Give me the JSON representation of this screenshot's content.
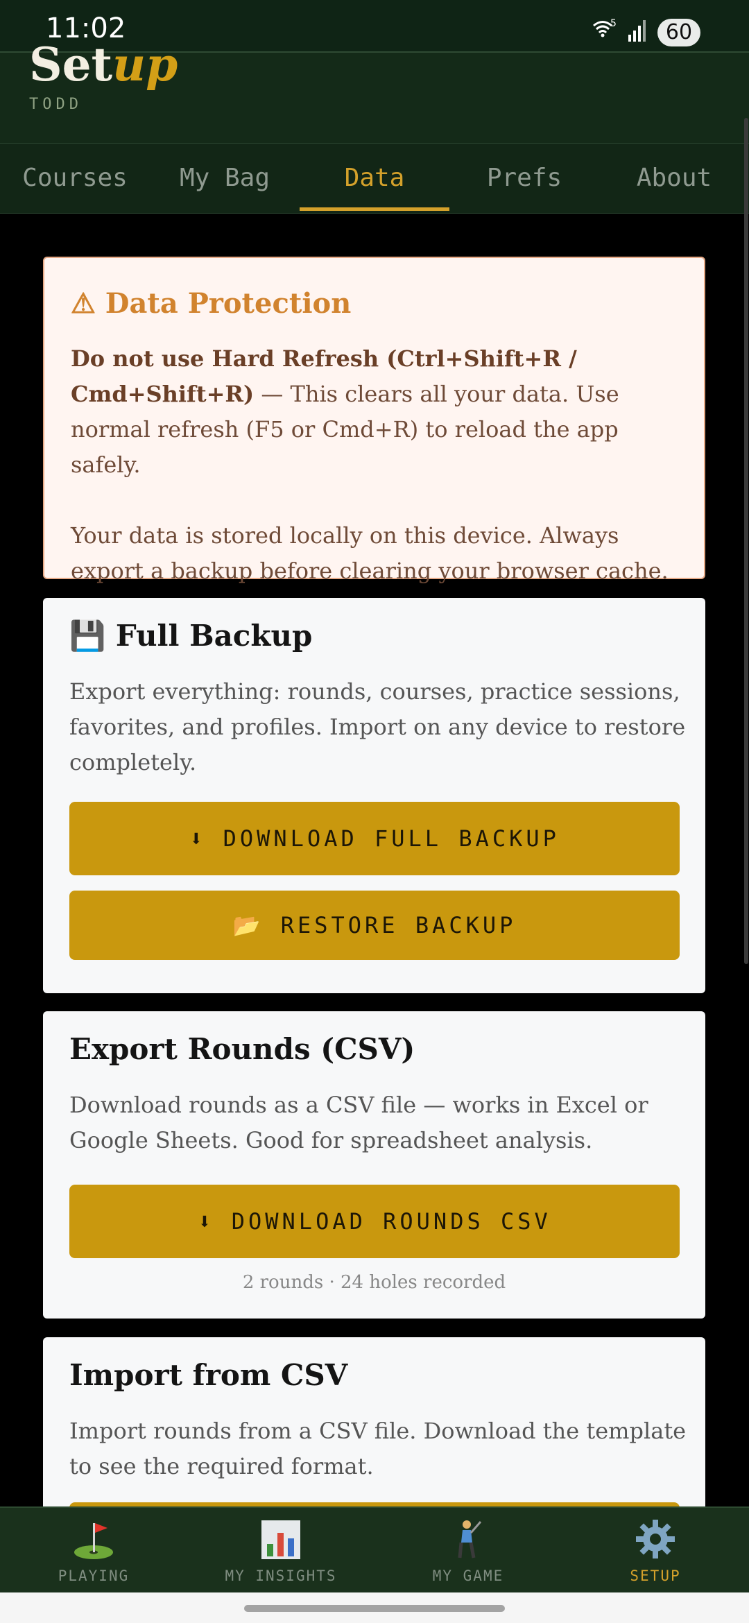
{
  "status": {
    "time": "11:02",
    "wifi_badge": "5",
    "battery": "60"
  },
  "header": {
    "title_main": "Set",
    "title_accent": "up",
    "user": "TODD"
  },
  "tabs": [
    {
      "label": "Courses"
    },
    {
      "label": "My Bag"
    },
    {
      "label": "Data"
    },
    {
      "label": "Prefs"
    },
    {
      "label": "About"
    }
  ],
  "active_tab": "Data",
  "alert": {
    "icon": "warning-icon",
    "title": "Data Protection",
    "bold": "Do not use Hard Refresh (Ctrl+Shift+R / Cmd+Shift+R)",
    "text": " — This clears all your data. Use normal refresh (F5 or Cmd+R) to reload the app safely.",
    "text2": "Your data is stored locally on this device. Always export a backup before clearing your browser cache."
  },
  "backup": {
    "icon": "floppy-disk-icon",
    "title": "Full Backup",
    "desc": "Export everything: rounds, courses, practice sessions, favorites, and profiles. Import on any device to restore completely.",
    "download_label": "⬇ DOWNLOAD FULL BACKUP",
    "restore_icon": "folder-icon",
    "restore_label": "RESTORE BACKUP"
  },
  "export": {
    "title": "Export Rounds (CSV)",
    "desc": "Download rounds as a CSV file — works in Excel or Google Sheets. Good for spreadsheet analysis.",
    "button_label": "⬇ DOWNLOAD ROUNDS CSV",
    "summary": "2 rounds · 24 holes recorded"
  },
  "import": {
    "title": "Import from CSV",
    "desc": "Import rounds from a CSV file. Download the template to see the required format."
  },
  "nav": [
    {
      "label": "PLAYING",
      "icon": "golf-flag-icon"
    },
    {
      "label": "MY INSIGHTS",
      "icon": "bar-chart-icon"
    },
    {
      "label": "MY GAME",
      "icon": "golfer-icon"
    },
    {
      "label": "SETUP",
      "icon": "gear-icon"
    }
  ],
  "active_nav": "SETUP",
  "colors": {
    "accent": "#d4a12b",
    "button": "#c9980e",
    "header": "#142a18",
    "alert_bg": "#fff5f1",
    "alert_title": "#d1832e"
  }
}
